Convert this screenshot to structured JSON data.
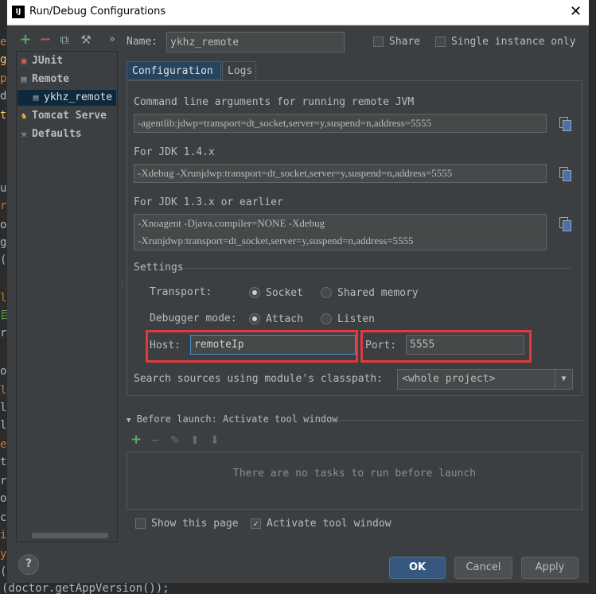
{
  "window": {
    "title": "Run/Debug Configurations",
    "app_icon_text": "IJ",
    "close_glyph": "✕"
  },
  "editor_margin": {
    "glyphs": [
      "e",
      "g",
      "p",
      "d",
      "t",
      "",
      "u",
      "r",
      "o",
      "g",
      "(",
      "",
      "l",
      "目",
      "r",
      "",
      "o",
      "l",
      "l",
      "l",
      "e",
      "t",
      "r",
      "o",
      "c",
      "i",
      "y",
      "("
    ],
    "bottom_code": "(doctor.getAppVersion());"
  },
  "toolbar": {
    "add": "+",
    "remove": "−",
    "copy": "⧉",
    "edit_defaults": "⚒",
    "more": "»"
  },
  "tree": {
    "items": [
      {
        "label": "JUnit",
        "icon": "junit-icon"
      },
      {
        "label": "Remote",
        "icon": "remote-icon"
      },
      {
        "label": "ykhz_remote",
        "icon": "remote-config-icon"
      },
      {
        "label": "Tomcat Serve",
        "icon": "tomcat-icon"
      },
      {
        "label": "Defaults",
        "icon": "wrench-icon"
      }
    ],
    "selected": "ykhz_remote"
  },
  "header": {
    "name_label": "Name:",
    "name_value": "ykhz_remote",
    "share_label": "Share",
    "single_instance_label": "Single instance only"
  },
  "tabs": [
    {
      "label": "Configuration",
      "active": true
    },
    {
      "label": "Logs",
      "active": false
    }
  ],
  "config": {
    "cmdline_label": "Command line arguments for running remote JVM",
    "cmdline_value": "-agentlib:jdwp=transport=dt_socket,server=y,suspend=n,address=5555",
    "jdk14_label": "For JDK 1.4.x",
    "jdk14_value": "-Xdebug -Xrunjdwp:transport=dt_socket,server=y,suspend=n,address=5555",
    "jdk13_label": "For JDK 1.3.x or earlier",
    "jdk13_line1": "-Xnoagent -Djava.compiler=NONE -Xdebug",
    "jdk13_line2": "-Xrunjdwp:transport=dt_socket,server=y,suspend=n,address=5555",
    "settings_label": "Settings",
    "transport_label": "Transport:",
    "transport_options": [
      "Socket",
      "Shared memory"
    ],
    "transport_selected": "Socket",
    "debugger_mode_label": "Debugger mode:",
    "debugger_mode_options": [
      "Attach",
      "Listen"
    ],
    "debugger_mode_selected": "Attach",
    "host_label": "Host:",
    "host_value": "remoteIp",
    "port_label": "Port:",
    "port_value": "5555",
    "classpath_label": "Search sources using module's classpath:",
    "classpath_value": "<whole project>"
  },
  "before_launch": {
    "header": "Before launch: Activate tool window",
    "empty_text": "There are no tasks to run before launch"
  },
  "footer": {
    "show_page_label": "Show this page",
    "show_page_checked": false,
    "activate_tool_label": "Activate tool window",
    "activate_tool_checked": true,
    "help": "?",
    "ok": "OK",
    "cancel": "Cancel",
    "apply": "Apply"
  },
  "colors": {
    "dialog_bg": "#3c3f41",
    "highlight_box": "#e0393e",
    "selection_bg": "#0d293e",
    "ok_button": "#365880",
    "add_icon": "#59a869",
    "remove_icon": "#c75450"
  }
}
